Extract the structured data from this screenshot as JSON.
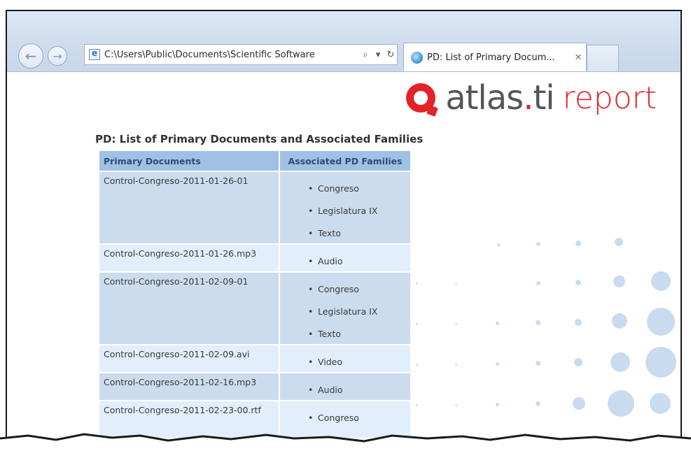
{
  "browser": {
    "address": "C:\\Users\\Public\\Documents\\Scientific Software",
    "search_glyph": "⌕",
    "dropdown_glyph": "▾",
    "refresh_glyph": "↻",
    "active_tab_title": "PD: List of Primary Docum...",
    "tab_close_glyph": "✕",
    "back_glyph": "←",
    "forward_glyph": "→"
  },
  "logo": {
    "atlas_text": "atlas",
    "dot_text": ".",
    "ti_text": "ti",
    "report_text": "report",
    "brand_color": "#e2232a"
  },
  "report": {
    "title": "PD: List of Primary Documents and Associated Families",
    "columns": [
      "Primary Documents",
      "Associated PD Families"
    ],
    "rows": [
      {
        "doc": "Control-Congreso-2011-01-26-01",
        "families": [
          "Congreso",
          "Legislatura IX",
          "Texto"
        ]
      },
      {
        "doc": "Control-Congreso-2011-01-26.mp3",
        "families": [
          "Audio"
        ]
      },
      {
        "doc": "Control-Congreso-2011-02-09-01",
        "families": [
          "Congreso",
          "Legislatura IX",
          "Texto"
        ]
      },
      {
        "doc": "Control-Congreso-2011-02-09.avi",
        "families": [
          "Video"
        ]
      },
      {
        "doc": "Control-Congreso-2011-02-16.mp3",
        "families": [
          "Audio"
        ]
      },
      {
        "doc": "Control-Congreso-2011-02-23-00.rtf",
        "families": [
          "Congreso"
        ]
      }
    ]
  }
}
